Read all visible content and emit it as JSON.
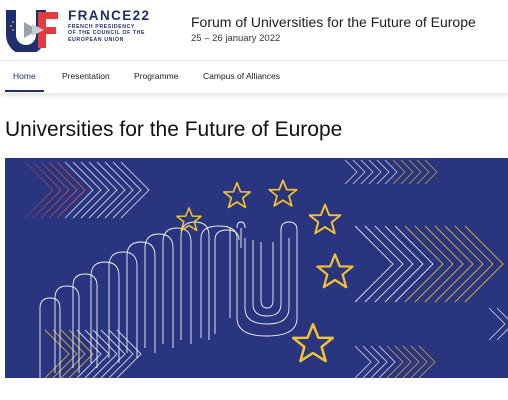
{
  "logo": {
    "title": "FRANCE22",
    "subtitle_lines": [
      "French Presidency",
      "of the Council of the",
      "European Union"
    ]
  },
  "event": {
    "title": "Forum of Universities for the Future of Europe",
    "dates": "25 – 26 january 2022"
  },
  "nav": {
    "items": [
      {
        "label": "Home",
        "active": true
      },
      {
        "label": "Presentation",
        "active": false
      },
      {
        "label": "Programme",
        "active": false
      },
      {
        "label": "Campus of Alliances",
        "active": false
      }
    ]
  },
  "page": {
    "title": "Universities for the Future of Europe"
  },
  "banner": {
    "background": "#2a3580",
    "star_color": "#f2c230",
    "line_color": "#ffffff",
    "icons": [
      "eu-star-icon",
      "u-monogram-icon",
      "chevron-pattern-icon"
    ]
  },
  "colors": {
    "brand_blue": "#1f2f6e",
    "brand_red": "#e43b41",
    "logo_gray": "#9aa0ad"
  }
}
